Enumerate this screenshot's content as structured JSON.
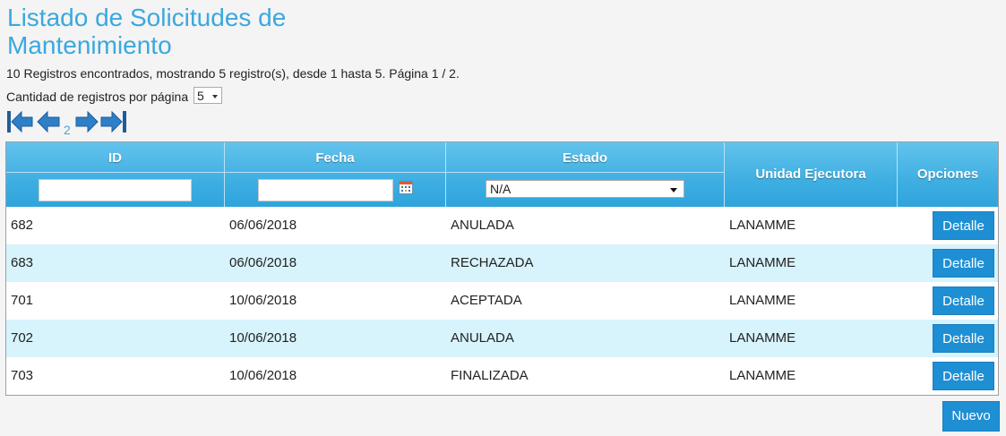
{
  "page": {
    "title": "Listado de Solicitudes de Mantenimiento",
    "summary": "10 Registros encontrados, mostrando 5 registro(s), desde 1 hasta 5. Página 1 / 2.",
    "per_page_label": "Cantidad de registros por página",
    "per_page_value": "5"
  },
  "pager": {
    "page_link": "2",
    "icons": [
      "first-page-icon",
      "previous-page-icon",
      "next-page-icon",
      "last-page-icon"
    ]
  },
  "table": {
    "columns": {
      "id": "ID",
      "fecha": "Fecha",
      "estado": "Estado",
      "unidad": "Unidad Ejecutora",
      "opciones": "Opciones"
    },
    "filters": {
      "id": "",
      "fecha": "",
      "estado": "N/A"
    },
    "rows": [
      {
        "id": "682",
        "fecha": "06/06/2018",
        "estado": "ANULADA",
        "unidad": "LANAMME",
        "action": "Detalle"
      },
      {
        "id": "683",
        "fecha": "06/06/2018",
        "estado": "RECHAZADA",
        "unidad": "LANAMME",
        "action": "Detalle"
      },
      {
        "id": "701",
        "fecha": "10/06/2018",
        "estado": "ACEPTADA",
        "unidad": "LANAMME",
        "action": "Detalle"
      },
      {
        "id": "702",
        "fecha": "10/06/2018",
        "estado": "ANULADA",
        "unidad": "LANAMME",
        "action": "Detalle"
      },
      {
        "id": "703",
        "fecha": "10/06/2018",
        "estado": "FINALIZADA",
        "unidad": "LANAMME",
        "action": "Detalle"
      }
    ]
  },
  "footer": {
    "new_button": "Nuevo"
  },
  "colors": {
    "accent": "#3aa8de",
    "header_gradient_top": "#63c3ec",
    "header_gradient_bottom": "#2ea4dc",
    "row_alt": "#d7f3fc",
    "button": "#1f8fd4"
  }
}
